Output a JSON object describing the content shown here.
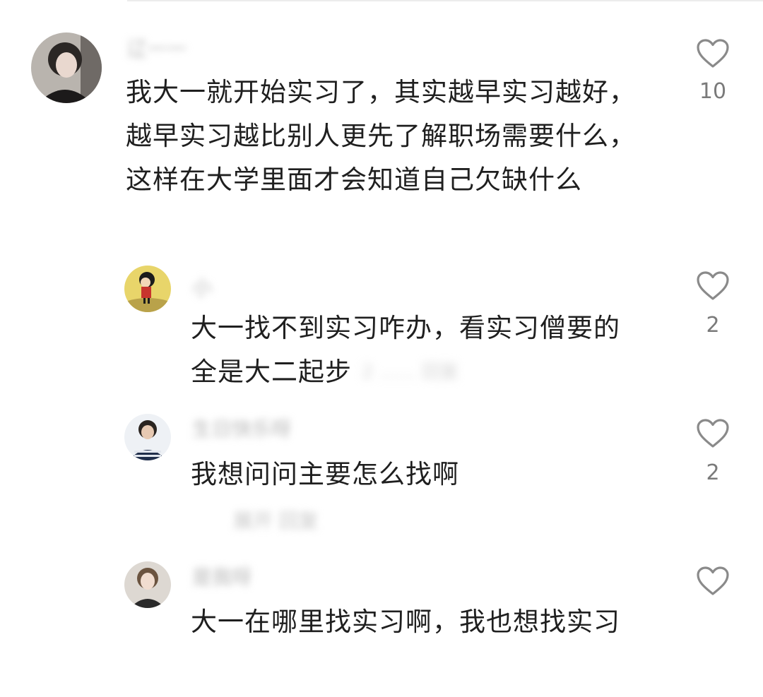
{
  "comments": [
    {
      "username": "辽一一",
      "text": "我大一就开始实习了，其实越早实习越好，\n越早实习越比别人更先了解职场需要什么，\n这样在大学里面才会知道自己欠缺什么",
      "likes": "10"
    },
    {
      "username": "小",
      "text": "大一找不到实习咋办，看实习僧要的\n全是大二起步",
      "trailing_blurred": "2 …… 回复",
      "likes": "2"
    },
    {
      "username": "生日快乐呀",
      "text": "我想问问主要怎么找啊",
      "reply_link": "展开 回复",
      "likes": "2"
    },
    {
      "username": "是我呀",
      "text": "大一在哪里找实习啊，我也想找实习",
      "likes": ""
    }
  ],
  "colors": {
    "text": "#1f1f1f",
    "muted": "#7a7a7a",
    "icon_stroke": "#8a8a8a",
    "background": "#ffffff"
  },
  "icons": {
    "like": "heart-outline-icon"
  }
}
